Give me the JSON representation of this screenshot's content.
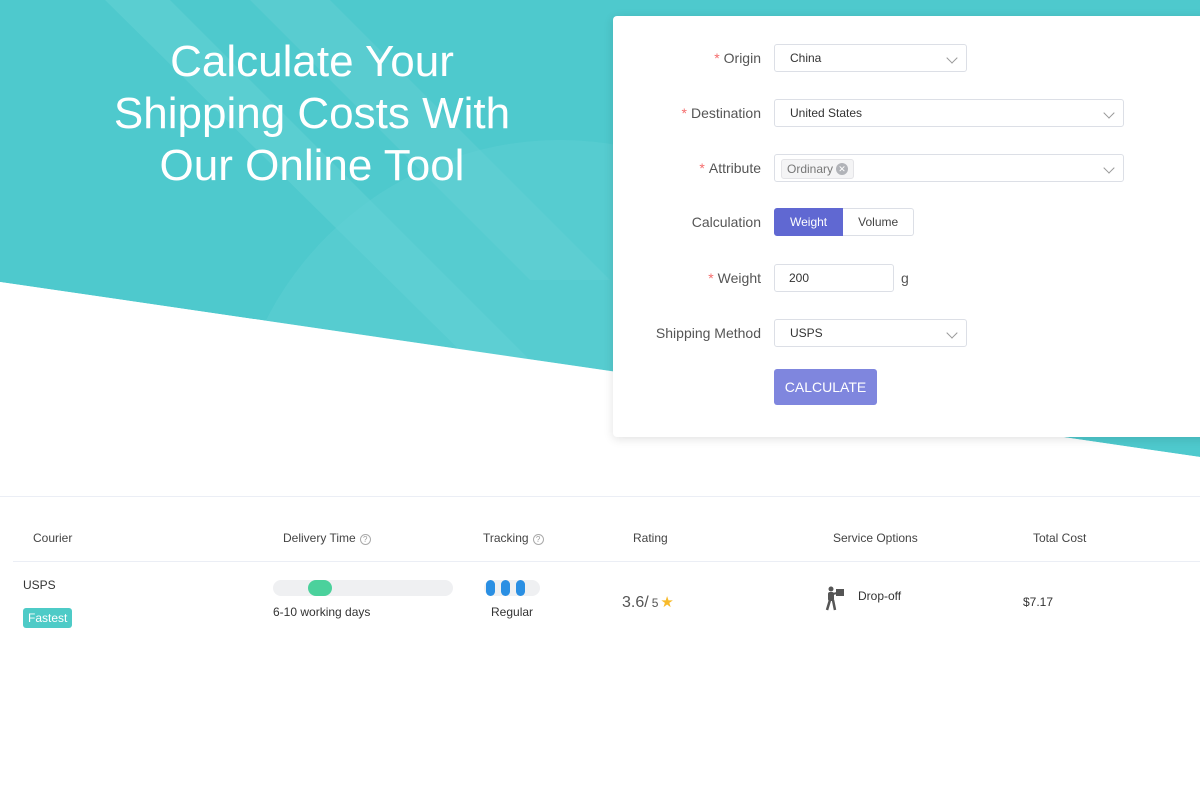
{
  "hero": {
    "title_line1": "Calculate Your",
    "title_line2": "Shipping Costs With",
    "title_line3": "Our Online Tool",
    "color": "#4ec9cd"
  },
  "form": {
    "required_mark": "*",
    "origin": {
      "label": "Origin",
      "value": "China"
    },
    "destination": {
      "label": "Destination",
      "value": "United States"
    },
    "attribute": {
      "label": "Attribute",
      "tag": "Ordinary"
    },
    "calculation": {
      "label": "Calculation",
      "options": [
        "Weight",
        "Volume"
      ],
      "selected": "Weight"
    },
    "weight": {
      "label": "Weight",
      "value": "200",
      "unit": "g"
    },
    "shipping_method": {
      "label": "Shipping Method",
      "value": "USPS"
    },
    "calculate_label": "CALCULATE",
    "accent": "#6068d2"
  },
  "results": {
    "headers": {
      "courier": "Courier",
      "delivery_time": "Delivery Time",
      "tracking": "Tracking",
      "rating": "Rating",
      "service_options": "Service Options",
      "total_cost": "Total Cost"
    },
    "help_glyph": "?",
    "rows": [
      {
        "courier": "USPS",
        "badge": "Fastest",
        "delivery_time": "6-10 working days",
        "tracking_level": "Regular",
        "rating_value": "3.6/",
        "rating_max": "5",
        "service_option": "Drop-off",
        "total_cost": "$7.17"
      }
    ]
  }
}
